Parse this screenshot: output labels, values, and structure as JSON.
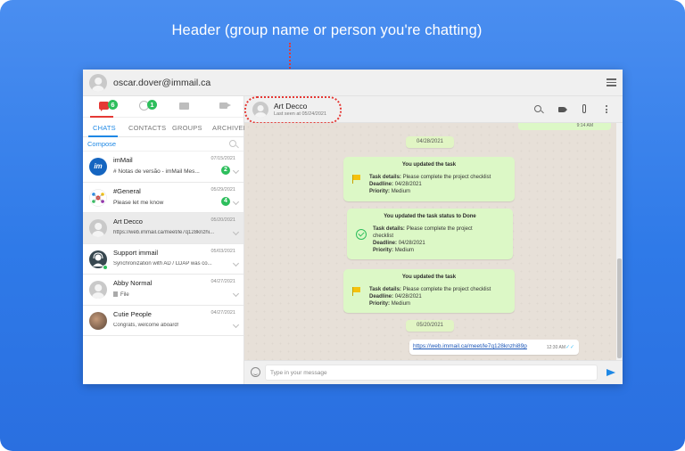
{
  "annotation": {
    "header_label": "Header (group name or person you're chatting)"
  },
  "top_bar": {
    "user_email": "oscar.dover@immail.ca"
  },
  "icon_tabs": {
    "chats_badge": "6",
    "contacts_badge": "1"
  },
  "text_tabs": [
    "CHATS",
    "CONTACTS",
    "GROUPS",
    "ARCHIVED"
  ],
  "compose_label": "Compose",
  "chats": [
    {
      "name": "imMail",
      "date": "07/15/2021",
      "message": "# Notas de versão - imMail Mes...",
      "badge": "2"
    },
    {
      "name": "#General",
      "date": "05/29/2021",
      "message": "Please let me know",
      "badge": "4"
    },
    {
      "name": "Art Decco",
      "date": "05/20/2021",
      "message": "https://web.immail.ca/meet/le7q128knzhi..."
    },
    {
      "name": "Support immail",
      "date": "05/03/2021",
      "message": "Synchronization with AD / LDAP was co..."
    },
    {
      "name": "Abby Normal",
      "date": "04/27/2021",
      "message": "File"
    },
    {
      "name": "Cutie People",
      "date": "04/27/2021",
      "message": "Congrats, welcome aboard!"
    }
  ],
  "chat_header": {
    "name": "Art Decco",
    "last_seen": "Last seen at 05/24/2021"
  },
  "messages": {
    "top_time": "9:14 AM",
    "date1": "04/28/2021",
    "date2": "05/20/2021",
    "task1": {
      "title": "You updated the task",
      "details_label": "Task details:",
      "details": "Please complete the project checklist",
      "deadline_label": "Deadline:",
      "deadline": "04/28/2021",
      "priority_label": "Priority:",
      "priority": "Medium"
    },
    "task2": {
      "title": "You updated the task status to Done",
      "details_label": "Task details:",
      "details_line1": "Please complete the project",
      "details_line2": "checklist",
      "deadline_label": "Deadline:",
      "deadline": "04/28/2021",
      "priority_label": "Priority:",
      "priority": "Medium"
    },
    "task3": {
      "title": "You updated the task",
      "details_label": "Task details:",
      "details": "Please complete the project checklist",
      "deadline_label": "Deadline:",
      "deadline": "04/28/2021",
      "priority_label": "Priority:",
      "priority": "Medium"
    },
    "link": {
      "text": "https://web.immail.ca/meet/le7q128knzhi89p",
      "time": "12:30 AM"
    }
  },
  "input": {
    "placeholder": "Type in your message"
  },
  "colors": {
    "accent": "#1e88e5",
    "badge": "#2dbe5c",
    "outline": "#e53935",
    "bubble": "#dcf8c6"
  }
}
